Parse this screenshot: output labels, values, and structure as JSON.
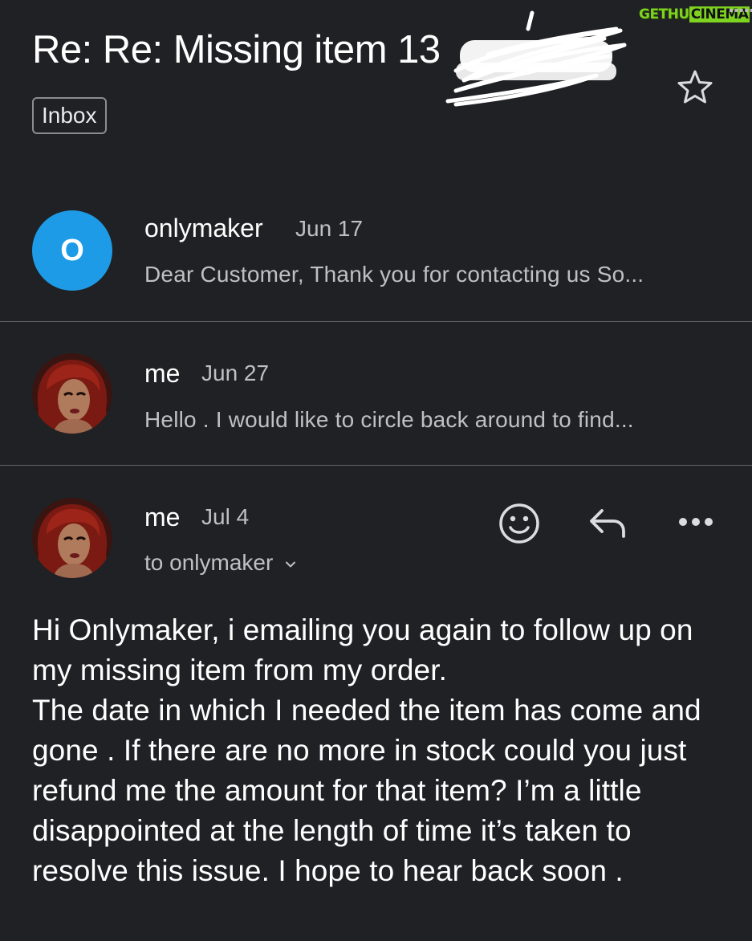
{
  "thread": {
    "subject": "Re: Re: Missing item 13",
    "label": "Inbox"
  },
  "watermark": {
    "part_a": "GETHU",
    "part_b": "CINEMA"
  },
  "messages": [
    {
      "avatar_letter": "O",
      "sender": "onlymaker",
      "date": "Jun 17",
      "snippet": "Dear Customer, Thank you for contacting us So..."
    },
    {
      "sender": "me",
      "date": "Jun 27",
      "snippet": "Hello . I would like to circle back around to find..."
    }
  ],
  "expanded": {
    "sender": "me",
    "date": "Jul 4",
    "to": "to onlymaker",
    "body": "Hi Onlymaker, i emailing you again to follow up on my missing item from my order.\nThe date in which I needed the item has come and gone . If there are no more in stock could you just refund me the amount for that item? I’m a little disappointed at the length of time it’s taken to resolve this issue. I hope to hear back soon ."
  },
  "icons": {
    "star": "star-icon",
    "emoji": "emoji-icon",
    "reply": "reply-icon",
    "more": "more-horiz-icon",
    "dropdown": "chevron-down-icon"
  },
  "colors": {
    "background": "#202124",
    "avatar_blue": "#1e9be6",
    "divider": "#5f6368",
    "watermark_green": "#7ed321"
  }
}
